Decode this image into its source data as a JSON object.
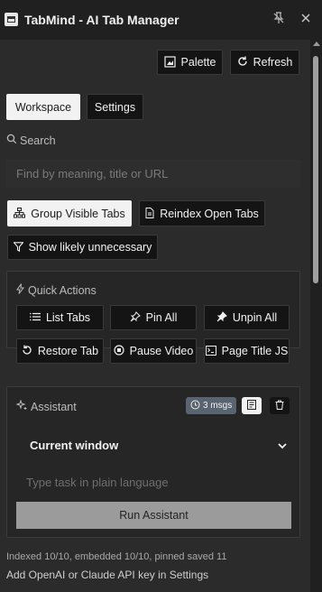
{
  "window": {
    "title": "TabMind - AI Tab Manager"
  },
  "toolbar": {
    "palette_label": "Palette",
    "refresh_label": "Refresh"
  },
  "tabs": {
    "workspace": "Workspace",
    "settings": "Settings"
  },
  "search": {
    "label": "Search",
    "placeholder": "Find by meaning, title or URL"
  },
  "actions": {
    "group_visible": "Group Visible Tabs",
    "reindex": "Reindex Open Tabs",
    "show_unnecessary": "Show likely unnecessary"
  },
  "quick_actions": {
    "title": "Quick Actions",
    "items": [
      {
        "label": "List Tabs",
        "icon": "list-icon"
      },
      {
        "label": "Pin All",
        "icon": "pin-icon"
      },
      {
        "label": "Unpin All",
        "icon": "unpin-icon"
      },
      {
        "label": "Restore Tab",
        "icon": "restore-icon"
      },
      {
        "label": "Pause Video",
        "icon": "pause-icon"
      },
      {
        "label": "Page Title JS",
        "icon": "terminal-icon"
      }
    ]
  },
  "assistant": {
    "title": "Assistant",
    "msgs_badge": "3 msgs",
    "scope_value": "Current window",
    "task_placeholder": "Type task in plain language",
    "run_label": "Run Assistant"
  },
  "status": {
    "index_line": "Indexed 10/10, embedded 10/10, pinned saved 11",
    "api_hint": "Add OpenAI or Claude API key in Settings"
  },
  "colors": {
    "background": "#2b2b2b",
    "button_dark": "#141414",
    "button_light": "#f2f2f2",
    "badge": "#5a6470",
    "run_button": "#9b9b9b"
  }
}
